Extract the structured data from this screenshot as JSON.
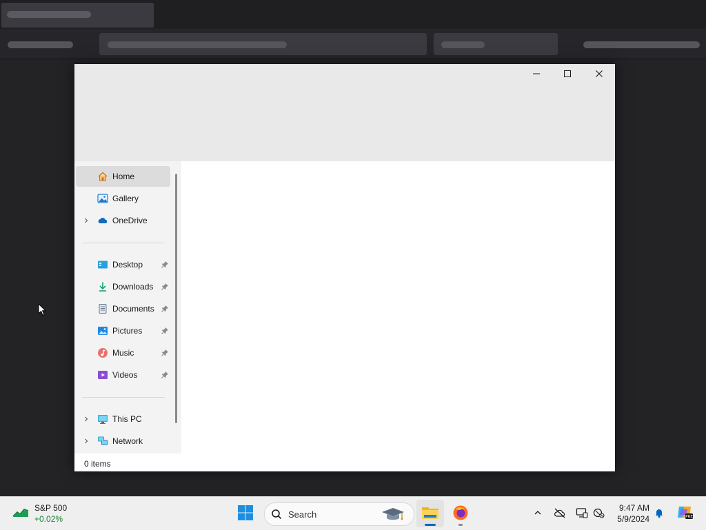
{
  "window": {
    "controls": {
      "minimize": "minimize-icon",
      "maximize": "maximize-icon",
      "close": "close-icon"
    }
  },
  "sidebar": {
    "items": [
      {
        "label": "Home",
        "icon": "home-icon",
        "selected": true,
        "expandable": false,
        "pinned": false
      },
      {
        "label": "Gallery",
        "icon": "gallery-icon",
        "selected": false,
        "expandable": false,
        "pinned": false
      },
      {
        "label": "OneDrive",
        "icon": "onedrive-icon",
        "selected": false,
        "expandable": true,
        "pinned": false
      },
      {
        "label": "Desktop",
        "icon": "desktop-folder-icon",
        "selected": false,
        "expandable": false,
        "pinned": true
      },
      {
        "label": "Downloads",
        "icon": "downloads-folder-icon",
        "selected": false,
        "expandable": false,
        "pinned": true
      },
      {
        "label": "Documents",
        "icon": "documents-folder-icon",
        "selected": false,
        "expandable": false,
        "pinned": true
      },
      {
        "label": "Pictures",
        "icon": "pictures-folder-icon",
        "selected": false,
        "expandable": false,
        "pinned": true
      },
      {
        "label": "Music",
        "icon": "music-folder-icon",
        "selected": false,
        "expandable": false,
        "pinned": true
      },
      {
        "label": "Videos",
        "icon": "videos-folder-icon",
        "selected": false,
        "expandable": false,
        "pinned": true
      },
      {
        "label": "This PC",
        "icon": "this-pc-icon",
        "selected": false,
        "expandable": true,
        "pinned": false
      },
      {
        "label": "Network",
        "icon": "network-icon",
        "selected": false,
        "expandable": true,
        "pinned": false
      }
    ]
  },
  "status": {
    "items_text": "0 items"
  },
  "taskbar": {
    "widget": {
      "name": "S&P 500",
      "change": "+0.02%",
      "change_color": "#1a7f37"
    },
    "search_placeholder": "Search",
    "apps": [
      "start-icon",
      "file-explorer-icon",
      "firefox-icon"
    ],
    "tray": [
      "chevron-up-icon",
      "onedrive-offline-icon",
      "display-icon",
      "network-offline-icon"
    ],
    "time": "9:47 AM",
    "date": "5/9/2024"
  },
  "colors": {
    "accent": "#0067c0",
    "titlebar": "#e9e9e9",
    "taskbar": "#efefef"
  }
}
